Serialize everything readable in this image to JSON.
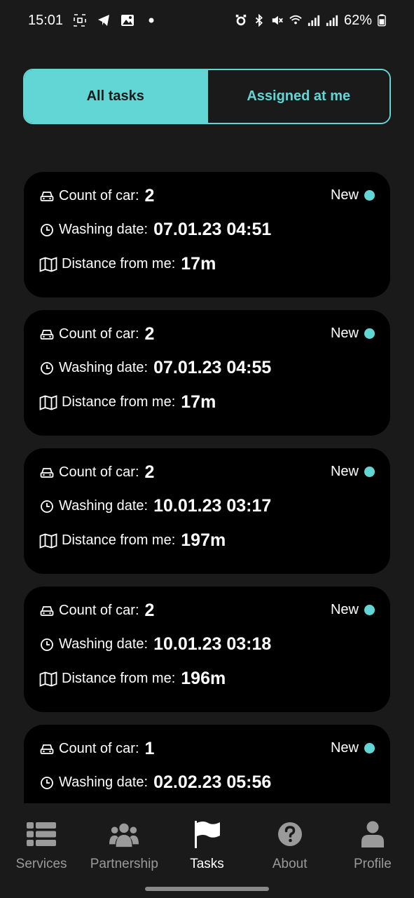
{
  "status_bar": {
    "time": "15:01",
    "left_icons": [
      "screenshot-icon",
      "telegram-icon",
      "gallery-icon",
      "dot-icon"
    ],
    "right_icons": [
      "alarm-icon",
      "bluetooth-icon",
      "mute-icon",
      "wifi-icon",
      "signal-icon",
      "signal-icon"
    ],
    "battery": "62%"
  },
  "tabs": {
    "all_tasks": "All tasks",
    "assigned": "Assigned at me",
    "active": "all_tasks"
  },
  "labels": {
    "count_of_car": "Count of car:",
    "washing_date": "Washing date:",
    "distance": "Distance from me:"
  },
  "tasks": [
    {
      "count": "2",
      "date": "07.01.23 04:51",
      "distance": "17m",
      "status": "New"
    },
    {
      "count": "2",
      "date": "07.01.23 04:55",
      "distance": "17m",
      "status": "New"
    },
    {
      "count": "2",
      "date": "10.01.23 03:17",
      "distance": "197m",
      "status": "New"
    },
    {
      "count": "2",
      "date": "10.01.23 03:18",
      "distance": "196m",
      "status": "New"
    },
    {
      "count": "1",
      "date": "02.02.23 05:56",
      "distance": "",
      "status": "New"
    }
  ],
  "nav": [
    {
      "label": "Services",
      "icon": "list-icon"
    },
    {
      "label": "Partnership",
      "icon": "users-icon"
    },
    {
      "label": "Tasks",
      "icon": "flag-icon"
    },
    {
      "label": "About",
      "icon": "question-icon"
    },
    {
      "label": "Profile",
      "icon": "user-icon"
    }
  ],
  "colors": {
    "accent": "#62d6d4",
    "background": "#1a1a1a",
    "card": "#000000",
    "inactive_nav": "#9a9a9a"
  }
}
